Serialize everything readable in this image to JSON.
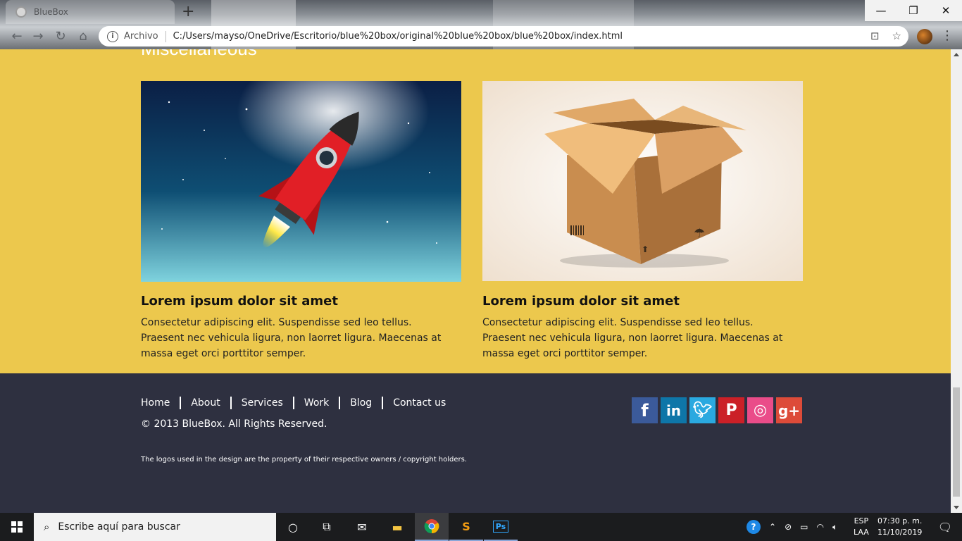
{
  "browser": {
    "tab_title": "BlueBox",
    "address_prefix": "Archivo",
    "url": "C:/Users/mayso/OneDrive/Escritorio/blue%20box/original%20blue%20box/blue%20box/index.html"
  },
  "section": {
    "title": "Miscellaneous"
  },
  "cards": [
    {
      "heading": "Lorem ipsum dolor sit amet",
      "text": "Consectetur adipiscing elit. Suspendisse sed leo tellus. Praesent nec vehicula ligura, non laorret ligura. Maecenas at massa eget orci porttitor semper."
    },
    {
      "heading": "Lorem ipsum dolor sit amet",
      "text": "Consectetur adipiscing elit. Suspendisse sed leo tellus. Praesent nec vehicula ligura, non laorret ligura. Maecenas at massa eget orci porttitor semper."
    }
  ],
  "footer": {
    "nav": [
      "Home",
      "About",
      "Services",
      "Work",
      "Blog",
      "Contact us"
    ],
    "copyright": "© 2013 BlueBox. All Rights Reserved.",
    "disclaimer": "The logos used in the design are the property of their respective owners / copyright holders.",
    "social": [
      {
        "icon": "facebook-icon",
        "glyph": "f",
        "color": "#3b5a9a"
      },
      {
        "icon": "linkedin-icon",
        "glyph": "in",
        "color": "#0e76a8"
      },
      {
        "icon": "twitter-icon",
        "glyph": "t",
        "color": "#2aa9e0"
      },
      {
        "icon": "pinterest-icon",
        "glyph": "P",
        "color": "#cb2027"
      },
      {
        "icon": "dribbble-icon",
        "glyph": "◎",
        "color": "#ea4c89"
      },
      {
        "icon": "google-plus-icon",
        "glyph": "g+",
        "color": "#dd4b39"
      }
    ]
  },
  "taskbar": {
    "search_placeholder": "Escribe aquí para buscar",
    "lang_top": "ESP",
    "lang_bottom": "LAA",
    "time": "07:30 p. m.",
    "date": "11/10/2019"
  },
  "colors": {
    "section_bg": "#ecc84d",
    "footer_bg": "#2e3040"
  }
}
